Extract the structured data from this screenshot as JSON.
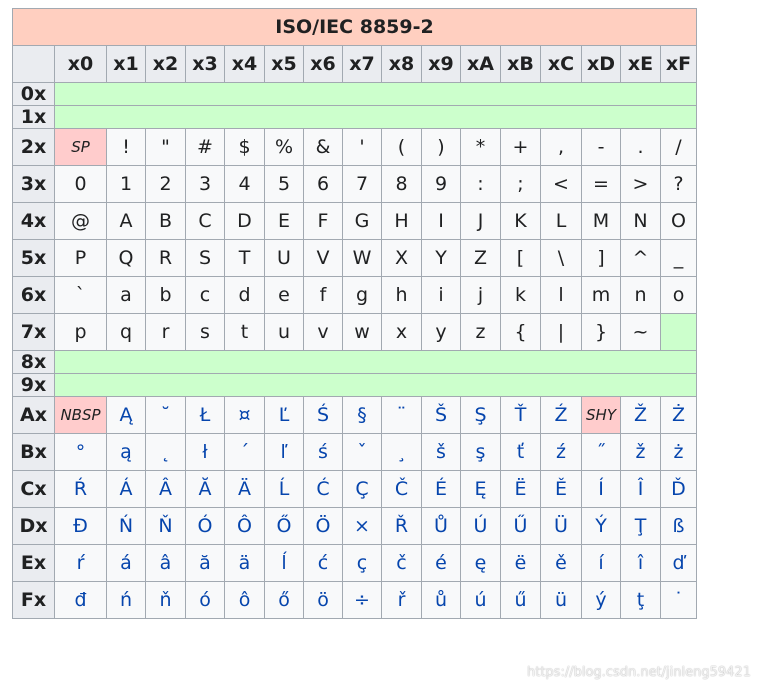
{
  "title": "ISO/IEC 8859-2",
  "column_headers": [
    "x0",
    "x1",
    "x2",
    "x3",
    "x4",
    "x5",
    "x6",
    "x7",
    "x8",
    "x9",
    "xA",
    "xB",
    "xC",
    "xD",
    "xE",
    "xF"
  ],
  "rows": [
    {
      "label": "0x",
      "cells": null
    },
    {
      "label": "1x",
      "cells": null
    },
    {
      "label": "2x",
      "cells": [
        "SP",
        "!",
        "\"",
        "#",
        "$",
        "%",
        "&",
        "'",
        "(",
        ")",
        "*",
        "+",
        ",",
        "-",
        ".",
        "/"
      ]
    },
    {
      "label": "3x",
      "cells": [
        "0",
        "1",
        "2",
        "3",
        "4",
        "5",
        "6",
        "7",
        "8",
        "9",
        ":",
        ";",
        "<",
        "=",
        ">",
        "?"
      ]
    },
    {
      "label": "4x",
      "cells": [
        "@",
        "A",
        "B",
        "C",
        "D",
        "E",
        "F",
        "G",
        "H",
        "I",
        "J",
        "K",
        "L",
        "M",
        "N",
        "O"
      ]
    },
    {
      "label": "5x",
      "cells": [
        "P",
        "Q",
        "R",
        "S",
        "T",
        "U",
        "V",
        "W",
        "X",
        "Y",
        "Z",
        "[",
        "\\",
        "]",
        "^",
        "_"
      ]
    },
    {
      "label": "6x",
      "cells": [
        "`",
        "a",
        "b",
        "c",
        "d",
        "e",
        "f",
        "g",
        "h",
        "i",
        "j",
        "k",
        "l",
        "m",
        "n",
        "o"
      ]
    },
    {
      "label": "7x",
      "cells": [
        "p",
        "q",
        "r",
        "s",
        "t",
        "u",
        "v",
        "w",
        "x",
        "y",
        "z",
        "{",
        "|",
        "}",
        "~",
        null
      ]
    },
    {
      "label": "8x",
      "cells": null
    },
    {
      "label": "9x",
      "cells": null
    },
    {
      "label": "Ax",
      "cells": [
        "NBSP",
        "Ą",
        "˘",
        "Ł",
        "¤",
        "Ľ",
        "Ś",
        "§",
        "¨",
        "Š",
        "Ş",
        "Ť",
        "Ź",
        "SHY",
        "Ž",
        "Ż"
      ]
    },
    {
      "label": "Bx",
      "cells": [
        "°",
        "ą",
        "˛",
        "ł",
        "´",
        "ľ",
        "ś",
        "ˇ",
        "¸",
        "š",
        "ş",
        "ť",
        "ź",
        "˝",
        "ž",
        "ż"
      ]
    },
    {
      "label": "Cx",
      "cells": [
        "Ŕ",
        "Á",
        "Â",
        "Ă",
        "Ä",
        "Ĺ",
        "Ć",
        "Ç",
        "Č",
        "É",
        "Ę",
        "Ë",
        "Ě",
        "Í",
        "Î",
        "Ď"
      ]
    },
    {
      "label": "Dx",
      "cells": [
        "Đ",
        "Ń",
        "Ň",
        "Ó",
        "Ô",
        "Ő",
        "Ö",
        "×",
        "Ř",
        "Ů",
        "Ú",
        "Ű",
        "Ü",
        "Ý",
        "Ţ",
        "ß"
      ]
    },
    {
      "label": "Ex",
      "cells": [
        "ŕ",
        "á",
        "â",
        "ă",
        "ä",
        "ĺ",
        "ć",
        "ç",
        "č",
        "é",
        "ę",
        "ë",
        "ě",
        "í",
        "î",
        "ď"
      ]
    },
    {
      "label": "Fx",
      "cells": [
        "đ",
        "ń",
        "ň",
        "ó",
        "ô",
        "ő",
        "ö",
        "÷",
        "ř",
        "ů",
        "ú",
        "ű",
        "ü",
        "ý",
        "ţ",
        "˙"
      ]
    }
  ],
  "special_cells": [
    "SP",
    "NBSP",
    "SHY"
  ],
  "extended_rows": [
    "Ax",
    "Bx",
    "Cx",
    "Dx",
    "Ex",
    "Fx"
  ],
  "watermark": "https://blog.csdn.net/jinleng59421",
  "colors": {
    "title_bg": "#ffcfc0",
    "header_bg": "#eaecf0",
    "cell_bg": "#f8f9fa",
    "control_bg": "#ccffcc",
    "special_bg": "#ffcccc",
    "extended_text": "#0645ad",
    "border": "#a2a9b1"
  }
}
